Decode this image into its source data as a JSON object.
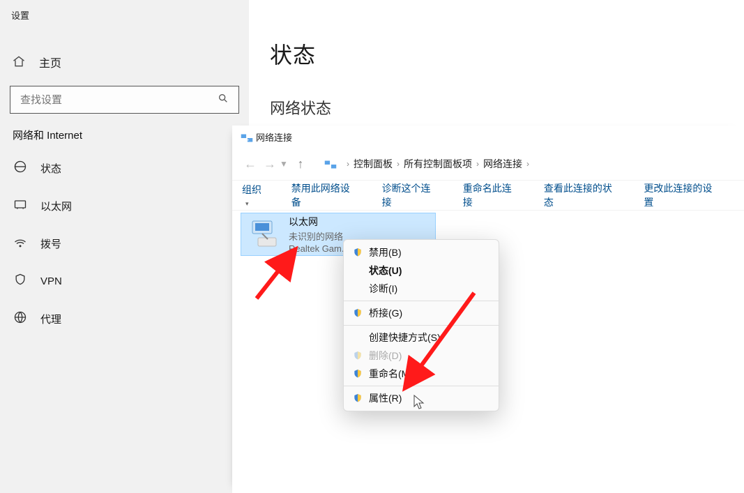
{
  "settings": {
    "title": "设置",
    "home": "主页",
    "search_placeholder": "查找设置",
    "section": "网络和 Internet",
    "items": [
      "状态",
      "以太网",
      "拨号",
      "VPN",
      "代理"
    ]
  },
  "main": {
    "title": "状态",
    "subtitle": "网络状态"
  },
  "explorer": {
    "title": "网络连接",
    "breadcrumb": [
      "控制面板",
      "所有控制面板项",
      "网络连接"
    ],
    "toolbar": [
      "组织",
      "禁用此网络设备",
      "诊断这个连接",
      "重命名此连接",
      "查看此连接的状态",
      "更改此连接的设置"
    ],
    "connection": {
      "name": "以太网",
      "status": "未识别的网络",
      "device": "Realtek Gam..."
    }
  },
  "context_menu": {
    "disable": "禁用(B)",
    "status": "状态(U)",
    "diagnose": "诊断(I)",
    "bridge": "桥接(G)",
    "shortcut": "创建快捷方式(S)",
    "delete": "删除(D)",
    "rename": "重命名(M)",
    "properties": "属性(R)"
  }
}
